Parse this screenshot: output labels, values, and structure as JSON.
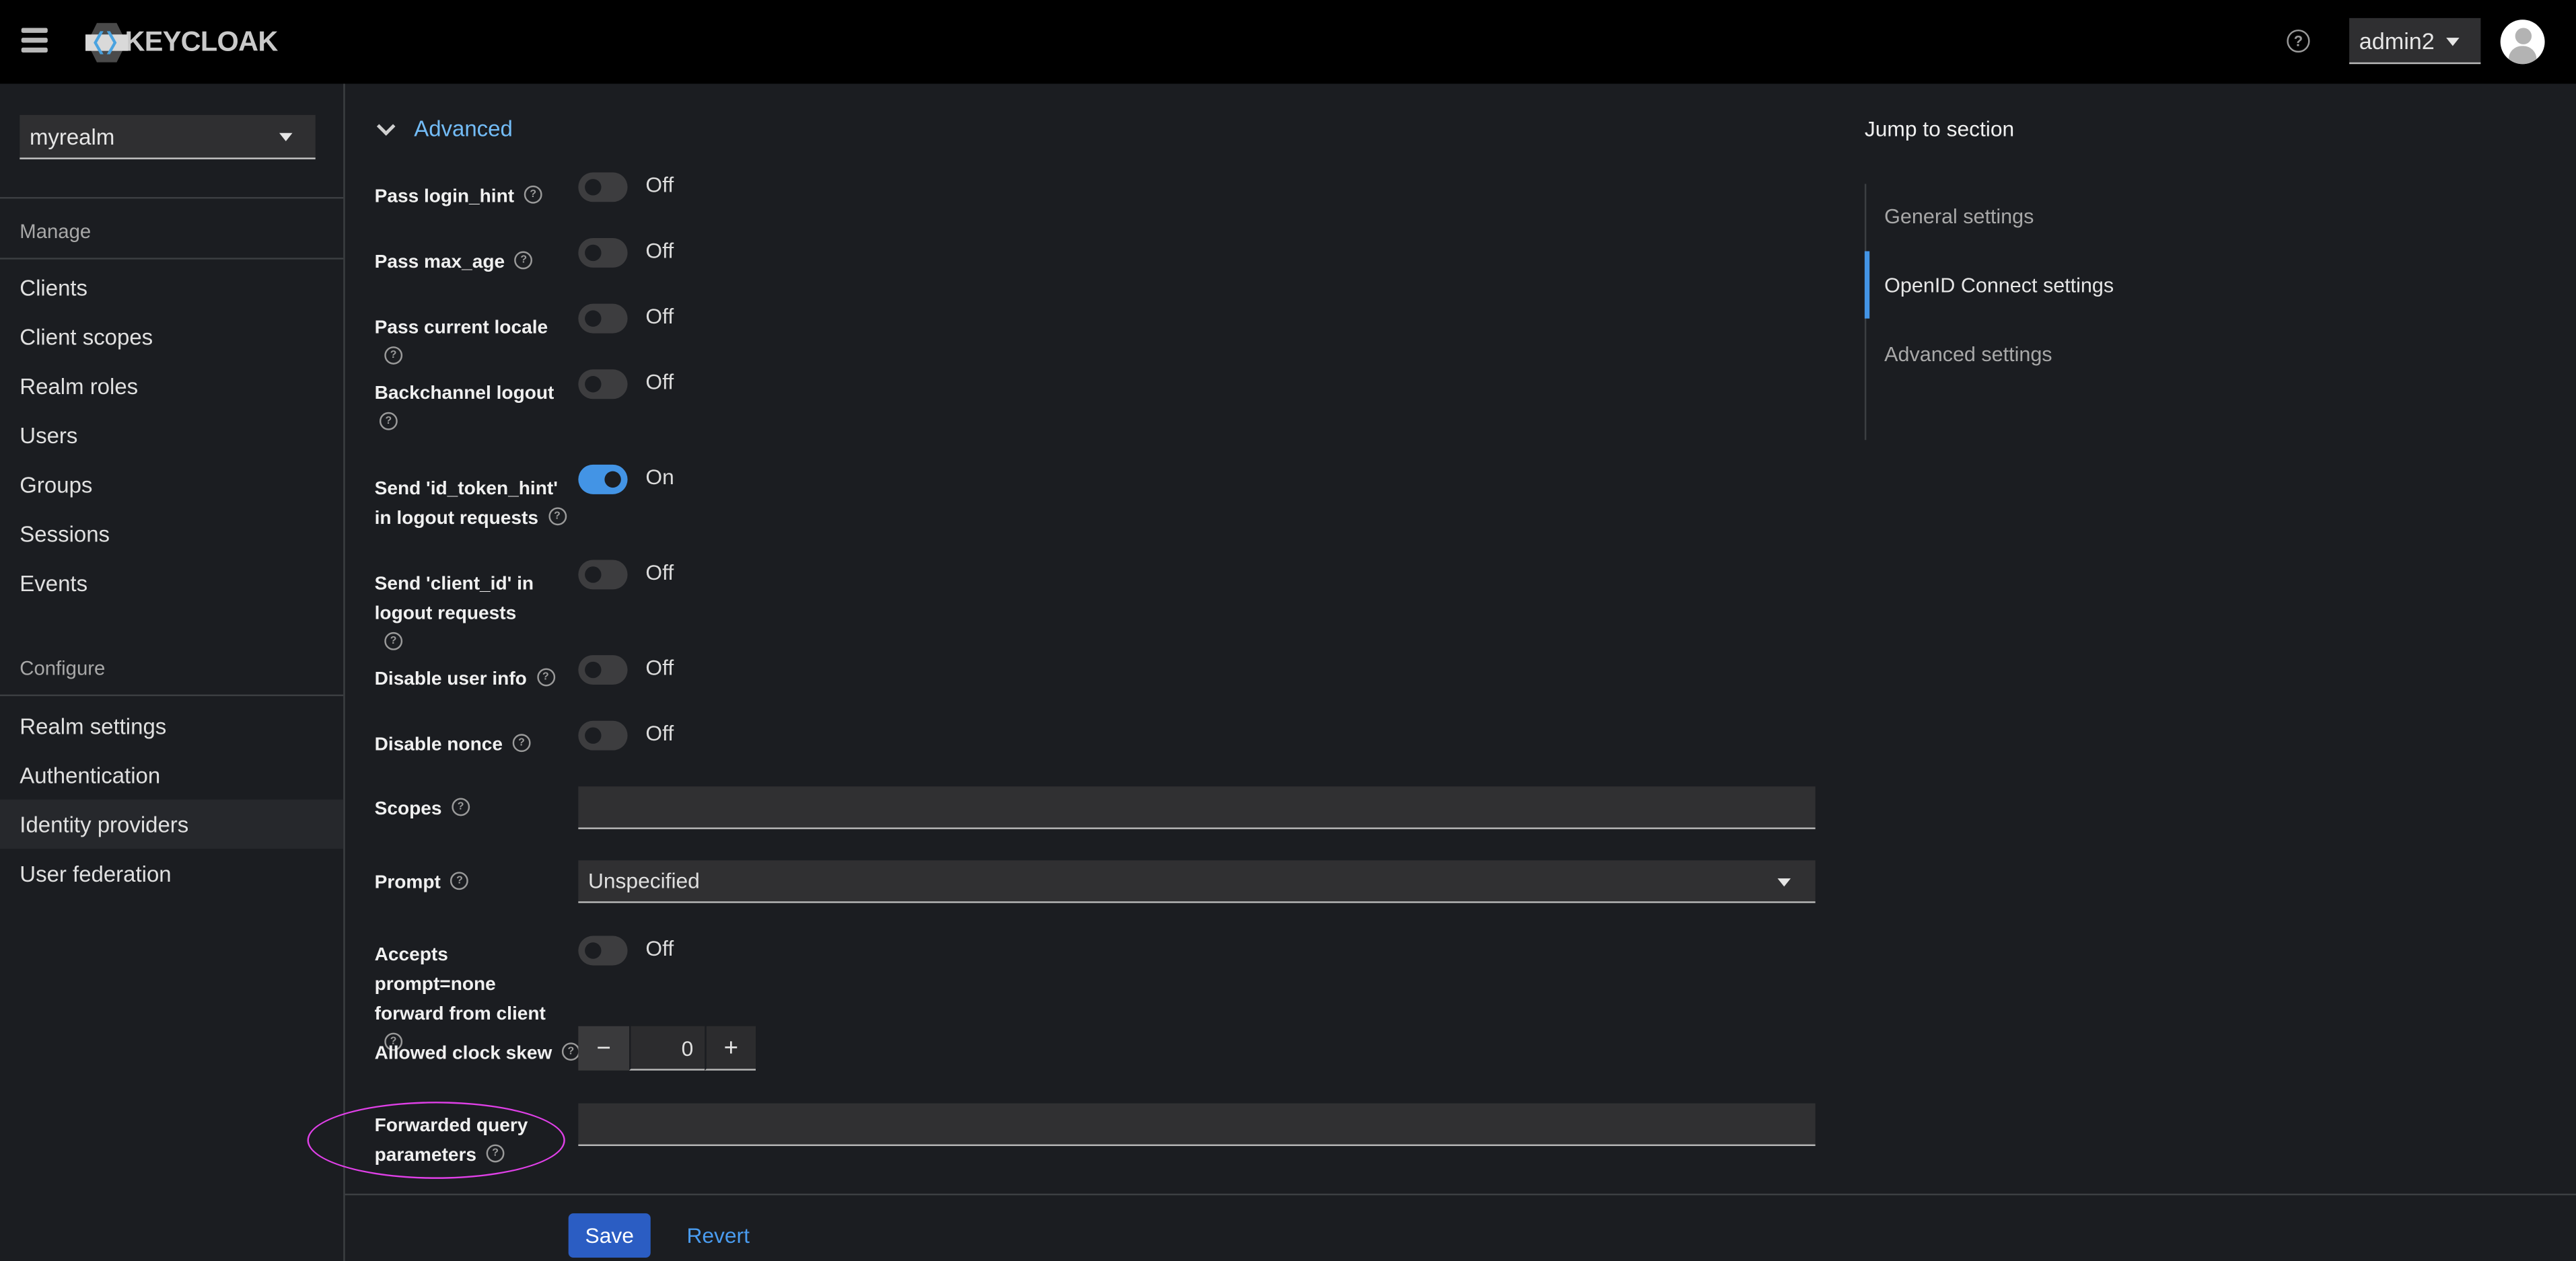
{
  "masthead": {
    "menu_icon": "hamburger-icon",
    "brand": "KEYCLOAK",
    "help_icon": "help-circle-icon",
    "user": "admin2",
    "avatar_icon": "user-avatar-icon"
  },
  "sidebar": {
    "realm": "myrealm",
    "groups": [
      {
        "title": "Manage",
        "items": [
          "Clients",
          "Client scopes",
          "Realm roles",
          "Users",
          "Groups",
          "Sessions",
          "Events"
        ]
      },
      {
        "title": "Configure",
        "items": [
          "Realm settings",
          "Authentication",
          "Identity providers",
          "User federation"
        ]
      }
    ],
    "active_item": "Identity providers"
  },
  "main": {
    "section_toggle": "Advanced",
    "fields": [
      {
        "label": "Pass login_hint",
        "type": "switch",
        "value": false,
        "state_label": "Off"
      },
      {
        "label": "Pass max_age",
        "type": "switch",
        "value": false,
        "state_label": "Off"
      },
      {
        "label": "Pass current locale",
        "type": "switch",
        "value": false,
        "state_label": "Off"
      },
      {
        "label": "Backchannel logout",
        "type": "switch",
        "value": false,
        "state_label": "Off"
      },
      {
        "label": "Send 'id_token_hint' in logout requests",
        "type": "switch",
        "value": true,
        "state_label": "On"
      },
      {
        "label": "Send 'client_id' in logout requests",
        "type": "switch",
        "value": false,
        "state_label": "Off"
      },
      {
        "label": "Disable user info",
        "type": "switch",
        "value": false,
        "state_label": "Off"
      },
      {
        "label": "Disable nonce",
        "type": "switch",
        "value": false,
        "state_label": "Off"
      },
      {
        "label": "Scopes",
        "type": "text",
        "value": ""
      },
      {
        "label": "Prompt",
        "type": "select",
        "value": "Unspecified"
      },
      {
        "label": "Accepts prompt=none forward from client",
        "type": "switch",
        "value": false,
        "state_label": "Off"
      },
      {
        "label": "Allowed clock skew",
        "type": "number",
        "value": "0",
        "minus": "−",
        "plus": "+"
      },
      {
        "label": "Forwarded query parameters",
        "type": "text",
        "value": ""
      }
    ],
    "highlighted_field": "Forwarded query parameters",
    "highlight_color": "#e040e8",
    "save_label": "Save",
    "revert_label": "Revert"
  },
  "jump_to_section": {
    "title": "Jump to section",
    "items": [
      "General settings",
      "OpenID Connect settings",
      "Advanced settings"
    ],
    "active": "OpenID Connect settings"
  },
  "colors": {
    "accent": "#4394e5",
    "primary_button": "#2b5dc3",
    "link": "#73bcf7",
    "background": "#1b1d21",
    "masthead": "#000000"
  }
}
